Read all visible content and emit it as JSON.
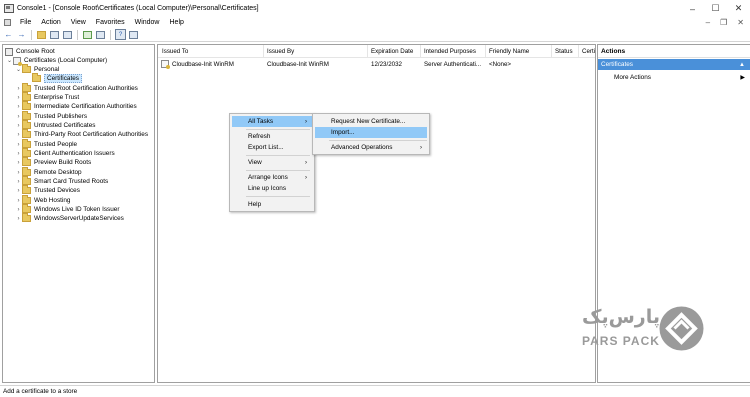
{
  "window": {
    "title": "Console1 - [Console Root\\Certificates (Local Computer)\\Personal\\Certificates]",
    "controls": {
      "minimize": "–",
      "maximize": "☐",
      "close": "✕"
    }
  },
  "menubar": {
    "items": [
      "File",
      "Action",
      "View",
      "Favorites",
      "Window",
      "Help"
    ],
    "right": {
      "minimize": "–",
      "restore": "❐",
      "close": "✕"
    }
  },
  "toolbar": {
    "back": "←",
    "forward": "→",
    "help": "?"
  },
  "tree": {
    "root": "Console Root",
    "computer": "Certificates (Local Computer)",
    "personal": "Personal",
    "certificates": "Certificates",
    "stores": [
      "Trusted Root Certification Authorities",
      "Enterprise Trust",
      "Intermediate Certification Authorities",
      "Trusted Publishers",
      "Untrusted Certificates",
      "Third-Party Root Certification Authorities",
      "Trusted People",
      "Client Authentication Issuers",
      "Preview Build Roots",
      "Remote Desktop",
      "Smart Card Trusted Roots",
      "Trusted Devices",
      "Web Hosting",
      "Windows Live ID Token Issuer",
      "WindowsServerUpdateServices"
    ]
  },
  "list": {
    "columns": [
      "Issued To",
      "Issued By",
      "Expiration Date",
      "Intended Purposes",
      "Friendly Name",
      "Status",
      "Certi"
    ],
    "rows": [
      [
        "Cloudbase-Init WinRM",
        "Cloudbase-Init WinRM",
        "12/23/2032",
        "Server Authenticati...",
        "<None>",
        "",
        ""
      ]
    ]
  },
  "actions": {
    "header": "Actions",
    "section": "Certificates",
    "section_caret": "▲",
    "more": "More Actions",
    "more_caret": "▶"
  },
  "context_menu": {
    "all_tasks": "All Tasks",
    "refresh": "Refresh",
    "export_list": "Export List...",
    "view": "View",
    "arrange_icons": "Arrange Icons",
    "line_up_icons": "Line up Icons",
    "help": "Help",
    "arrow": "›"
  },
  "submenu": {
    "request_new": "Request New Certificate...",
    "import": "Import...",
    "advanced": "Advanced Operations",
    "arrow": "›"
  },
  "statusbar": {
    "text": "Add a certificate to a store"
  },
  "logo": {
    "fa": "پارس‌پک",
    "en": "PARS PACK"
  },
  "colors": {
    "highlight": "#91c9f7",
    "actions_section": "#4a90d9",
    "folder": "#e8c860",
    "logo_gray": "#9a9a9a"
  }
}
